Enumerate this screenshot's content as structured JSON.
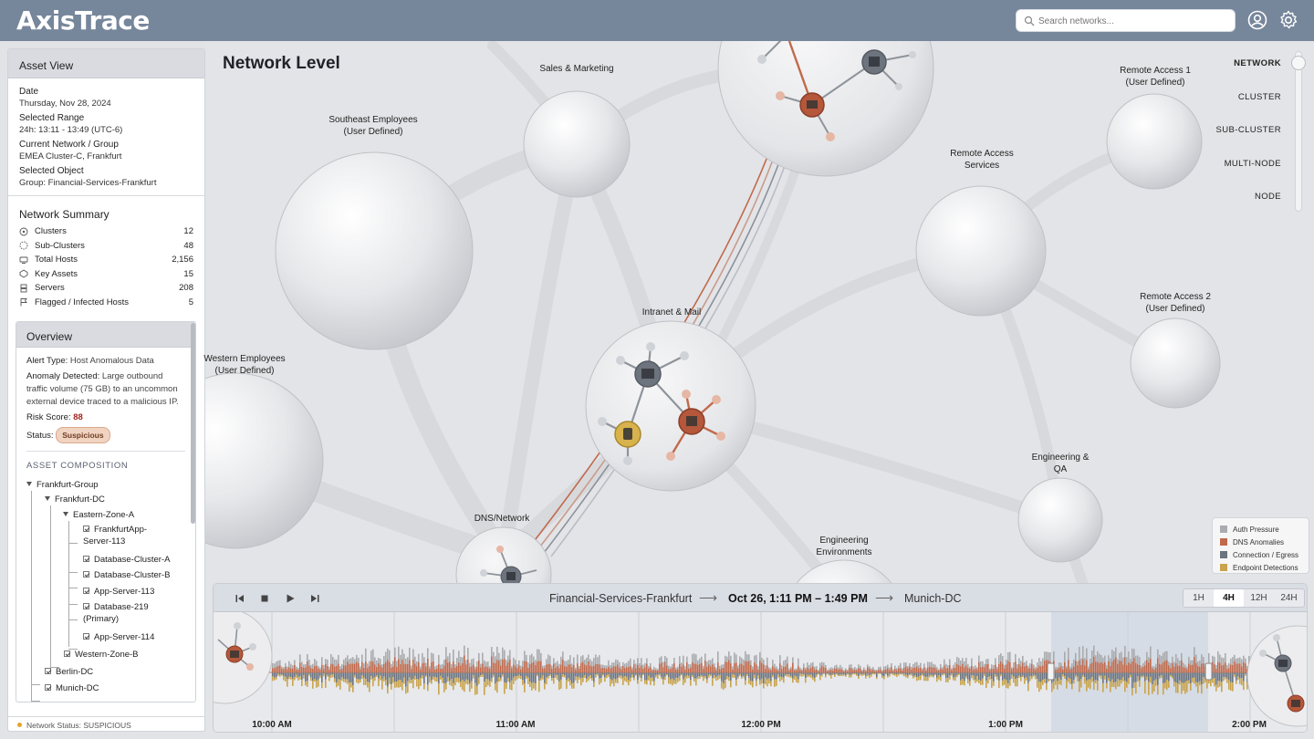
{
  "app": {
    "name": "AxisTrace"
  },
  "search": {
    "placeholder": "Search networks..."
  },
  "asset_view": {
    "title": "Asset View",
    "fields": [
      {
        "label": "Date",
        "value": "Thursday, Nov 28, 2024"
      },
      {
        "label": "Selected Range",
        "value": "24h: 13:11 - 13:49 (UTC-6)"
      },
      {
        "label": "Current Network / Group",
        "value": "EMEA Cluster-C, Frankfurt"
      },
      {
        "label": "Selected Object",
        "value": "Group: Financial-Services-Frankfurt"
      }
    ]
  },
  "summary": {
    "title": "Network Summary",
    "rows": [
      {
        "label": "Clusters",
        "value": "12",
        "icon": "cluster-icon"
      },
      {
        "label": "Sub-Clusters",
        "value": "48",
        "icon": "sub-cluster-icon"
      },
      {
        "label": "Total Hosts",
        "value": "2,156",
        "icon": "host-icon"
      },
      {
        "label": "Key Assets",
        "value": "15",
        "icon": "key-asset-icon"
      },
      {
        "label": "Servers",
        "value": "208",
        "icon": "server-icon"
      },
      {
        "label": "Flagged / Infected Hosts",
        "value": "5",
        "icon": "flag-icon"
      }
    ]
  },
  "overview": {
    "title": "Overview",
    "alert_type_label": "Alert Type:",
    "alert_type": "Host Anomalous Data",
    "anomaly_label": "Anomaly Detected:",
    "anomaly": "Large outbound traffic volume (75 GB) to an uncommon external device traced to a malicious IP.",
    "risk_label": "Risk Score:",
    "risk": "88",
    "status_label": "Status:",
    "status": "Suspicious",
    "composition_title": "ASSET COMPOSITION",
    "tree": {
      "frankfurt_group": "Frankfurt-Group",
      "frankfurt_dc": "Frankfurt-DC",
      "eastern_zone": "Eastern-Zone-A",
      "app113": "FrankfurtApp-Server-113",
      "dbA": "Database-Cluster-A",
      "dbB": "Database-Cluster-B",
      "app113b": "App-Server-113",
      "db219": "Database-219 (Primary)",
      "app114": "App-Server-114",
      "western_zone": "Western-Zone-B",
      "berlin": "Berlin-DC",
      "munich": "Munich-DC"
    }
  },
  "footer": {
    "status": "Network Status: SUSPICIOUS"
  },
  "main": {
    "title": "Network Level"
  },
  "nodes": {
    "sales": "Sales & Marketing",
    "southeast": "Southeast Employees (User Defined)",
    "western": "Western Employees (User Defined)",
    "intranet": "Intranet & Mail",
    "dns": "DNS/Network",
    "remote_services": "Remote Access Services",
    "remote1": "Remote Access 1 (User Defined)",
    "remote2": "Remote Access 2 (User Defined)",
    "engqa": "Engineering & QA",
    "engenv": "Engineering Environments"
  },
  "levels": [
    "NETWORK",
    "CLUSTER",
    "SUB-CLUSTER",
    "MULTI-NODE",
    "NODE"
  ],
  "active_level": "NETWORK",
  "legend": [
    {
      "label": "Auth Pressure",
      "color": "#a9abae"
    },
    {
      "label": "DNS Anomalies",
      "color": "#c06a4c"
    },
    {
      "label": "Connection / Egress",
      "color": "#6b7480"
    },
    {
      "label": "Endpoint Detections",
      "color": "#c9a44e"
    }
  ],
  "timeline": {
    "source": "Financial-Services-Frankfurt",
    "range": "Oct 26, 1:11 PM – 1:49 PM",
    "destination": "Munich-DC",
    "ranges": [
      "1H",
      "4H",
      "12H",
      "24H"
    ],
    "active_range": "4H",
    "ticks": [
      "10:00 AM",
      "11:00 AM",
      "12:00 PM",
      "1:00 PM",
      "2:00 PM"
    ]
  },
  "colors": {
    "topbar": "#76869b",
    "auth": "#a9abae",
    "dns": "#c06a4c",
    "egress": "#6b7480",
    "endpoint": "#c9a44e",
    "risk": "#a3251d"
  }
}
